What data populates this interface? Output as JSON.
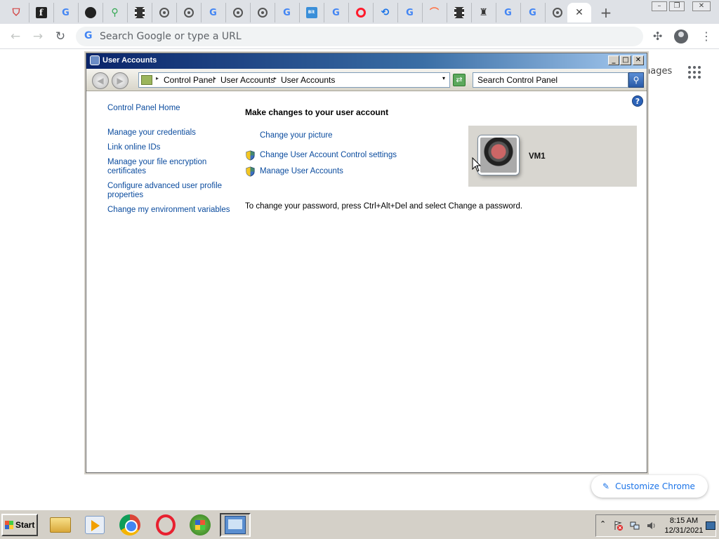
{
  "browser": {
    "tabs": [
      {
        "icon": "shield-icon",
        "glyph": "⛉"
      },
      {
        "icon": "f-logo-icon",
        "glyph": "f"
      },
      {
        "icon": "google-icon",
        "glyph": "G"
      },
      {
        "icon": "dark-circle-icon",
        "glyph": "●"
      },
      {
        "icon": "maps-pin-icon",
        "glyph": "⚲"
      },
      {
        "icon": "film-icon",
        "glyph": ""
      },
      {
        "icon": "globe-icon",
        "glyph": ""
      },
      {
        "icon": "globe-icon",
        "glyph": ""
      },
      {
        "icon": "google-icon",
        "glyph": "G"
      },
      {
        "icon": "globe-icon",
        "glyph": ""
      },
      {
        "icon": "globe-icon",
        "glyph": ""
      },
      {
        "icon": "google-icon",
        "glyph": "G"
      },
      {
        "icon": "bit-icon",
        "glyph": "Bit"
      },
      {
        "icon": "google-icon",
        "glyph": "G"
      },
      {
        "icon": "opera-icon",
        "glyph": ""
      },
      {
        "icon": "history-clock-icon",
        "glyph": "⟲"
      },
      {
        "icon": "google-icon",
        "glyph": "G"
      },
      {
        "icon": "rainbow-icon",
        "glyph": "⌒"
      },
      {
        "icon": "film-icon",
        "glyph": ""
      },
      {
        "icon": "incognito-icon",
        "glyph": "♜"
      },
      {
        "icon": "google-icon",
        "glyph": "G"
      },
      {
        "icon": "google-icon",
        "glyph": "G"
      },
      {
        "icon": "globe-icon",
        "glyph": ""
      },
      {
        "icon": "close-icon",
        "glyph": "✕",
        "active": true
      }
    ],
    "new_tab_glyph": "+",
    "omnibox_placeholder": "Search Google or type a URL",
    "omnibox_g": "G",
    "ntp_images_partial": "nages",
    "customize_label": "Customize Chrome",
    "customize_icon_glyph": "✎"
  },
  "window": {
    "title": "User Accounts",
    "title_buttons": {
      "minimize": "_",
      "maximize": "□",
      "close": "✕"
    },
    "address": {
      "crumbs": [
        "Control Panel",
        "User Accounts",
        "User Accounts"
      ],
      "separator_glyph": "▸",
      "dropdown_glyph": "▾"
    },
    "refresh_glyph": "⇄",
    "search_placeholder": "Search Control Panel",
    "search_glyph": "⚲",
    "help_glyph": "?",
    "nav_back_glyph": "◀",
    "nav_forward_glyph": "▶"
  },
  "tasks": {
    "home": "Control Panel Home",
    "links": [
      "Manage your credentials",
      "Link online IDs",
      "Manage your file encryption certificates",
      "Configure advanced user profile properties",
      "Change my environment variables"
    ]
  },
  "main": {
    "title": "Make changes to your user account",
    "links": {
      "change_picture": "Change your picture",
      "uac_settings": "Change User Account Control settings",
      "manage_accounts": "Manage User Accounts"
    },
    "password_note": "To change your password, press Ctrl+Alt+Del and select Change a password."
  },
  "user": {
    "name": "VM1"
  },
  "taskbar": {
    "start_label": "Start",
    "apps": [
      {
        "name": "file-explorer-icon"
      },
      {
        "name": "media-player-icon"
      },
      {
        "name": "chrome-icon"
      },
      {
        "name": "opera-icon"
      },
      {
        "name": "windows-orb-icon"
      },
      {
        "name": "control-panel-icon",
        "active": true
      }
    ],
    "tray_expand_glyph": "⌃",
    "clock_time": "8:15 AM",
    "clock_date": "12/31/2021"
  },
  "colors": {
    "link": "#0a4b9e",
    "titlebar_start": "#0a246a",
    "titlebar_end": "#a6caf0",
    "taskbar": "#d4d0c8",
    "chrome_tabstrip": "#dee1e6",
    "chrome_accent": "#1a73e8"
  }
}
